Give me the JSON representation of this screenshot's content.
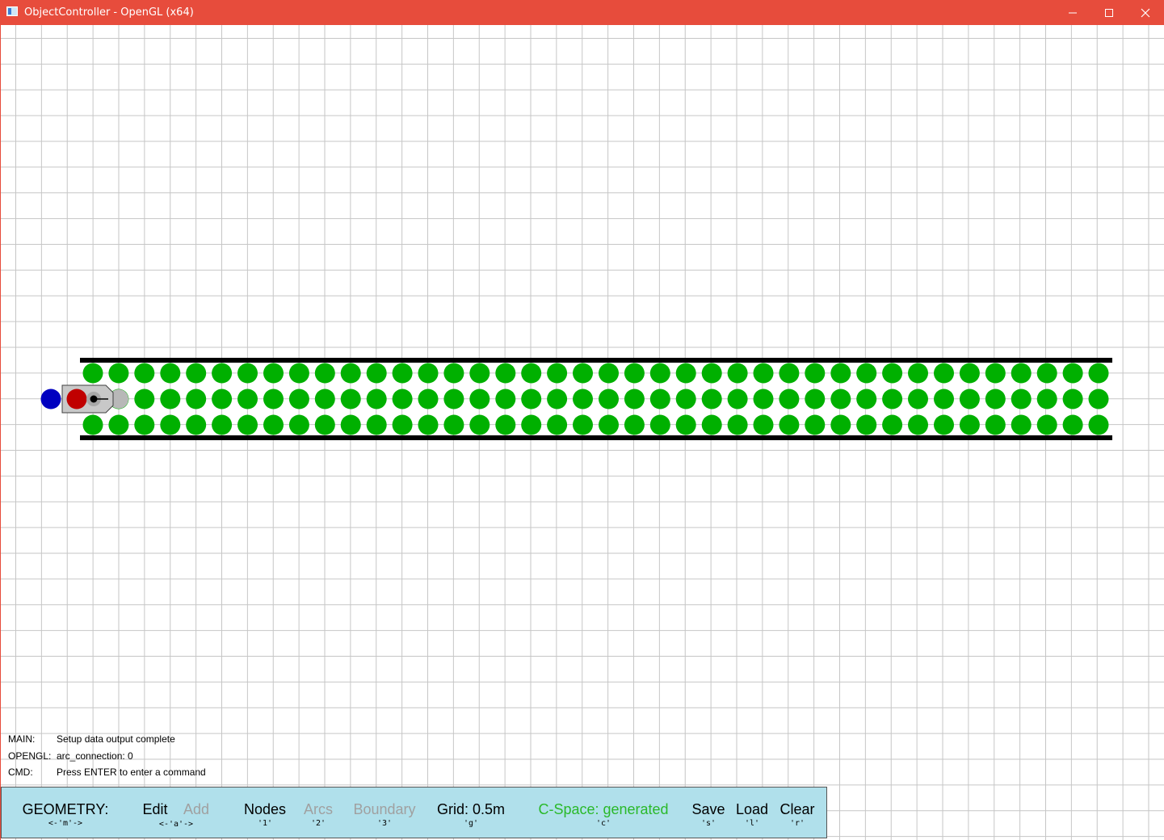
{
  "window": {
    "title": "ObjectController - OpenGL (x64)",
    "controls": {
      "minimize": "—",
      "maximize": "☐",
      "close": "✕"
    },
    "titlebar_color": "#e74c3c"
  },
  "scene": {
    "grid_color": "#c6c6c6",
    "node_color": "#00b000",
    "wall_color": "#000000",
    "node_columns": 40,
    "node_rows": 3,
    "robot": {
      "marker_left_color": "#0000c0",
      "body_color": "#c8c8c8",
      "wheel_color": "#c00000",
      "front_color": "#b8b8b8"
    }
  },
  "log": [
    {
      "label": "MAIN:",
      "message": "Setup data output complete"
    },
    {
      "label": "OPENGL:",
      "message": "arc_connection: 0"
    },
    {
      "label": "CMD:",
      "message": "Press ENTER to enter a command"
    }
  ],
  "toolbar": {
    "background": "#b0e0eb",
    "mode": {
      "label": "GEOMETRY:",
      "key": "<-'m'->"
    },
    "edit": {
      "label": "Edit",
      "key": "<-'a'->"
    },
    "add": {
      "label": "Add"
    },
    "nodes": {
      "label": "Nodes",
      "key": "'1'"
    },
    "arcs": {
      "label": "Arcs",
      "key": "'2'"
    },
    "boundary": {
      "label": "Boundary",
      "key": "'3'"
    },
    "grid": {
      "label": "Grid: 0.5m",
      "key": "'g'"
    },
    "cspace": {
      "label": "C-Space: generated",
      "key": "'c'"
    },
    "save": {
      "label": "Save",
      "key": "'s'"
    },
    "load": {
      "label": "Load",
      "key": "'l'"
    },
    "clear": {
      "label": "Clear",
      "key": "'r'"
    }
  }
}
